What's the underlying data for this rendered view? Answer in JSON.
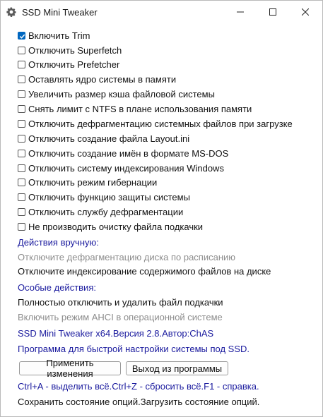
{
  "window": {
    "title": "SSD Mini Tweaker"
  },
  "options": [
    {
      "label": "Включить Trim",
      "checked": true
    },
    {
      "label": "Отключить Superfetch",
      "checked": false
    },
    {
      "label": "Отключить Prefetcher",
      "checked": false
    },
    {
      "label": "Оставлять ядро системы в памяти",
      "checked": false
    },
    {
      "label": "Увеличить размер кэша файловой системы",
      "checked": false
    },
    {
      "label": "Снять лимит с NTFS в плане использования памяти",
      "checked": false
    },
    {
      "label": "Отключить дефрагментацию системных файлов при загрузке",
      "checked": false
    },
    {
      "label": "Отключить создание файла Layout.ini",
      "checked": false
    },
    {
      "label": "Отключить создание имён в формате MS-DOS",
      "checked": false
    },
    {
      "label": "Отключить систему индексирования Windows",
      "checked": false
    },
    {
      "label": "Отключить режим гибернации",
      "checked": false
    },
    {
      "label": "Отключить функцию защиты системы",
      "checked": false
    },
    {
      "label": "Отключить службу дефрагментации",
      "checked": false
    },
    {
      "label": "Не производить очистку файла подкачки",
      "checked": false
    }
  ],
  "manual": {
    "heading": "Действия вручную:",
    "items": [
      {
        "label": "Отключите дефрагментацию диска по расписанию",
        "enabled": false
      },
      {
        "label": "Отключите индексирование содержимого файлов на диске",
        "enabled": true
      }
    ]
  },
  "special": {
    "heading": "Особые действия:",
    "items": [
      {
        "label": "Полностью отключить и удалить файл подкачки",
        "enabled": true
      },
      {
        "label": "Включить режим AHCI в операционной системе",
        "enabled": false
      }
    ]
  },
  "info": {
    "version": "SSD Mini Tweaker x64.Версия 2.8.Автор:ChAS",
    "description": "Программа для быстрой настройки системы под SSD."
  },
  "buttons": {
    "apply": "Применить изменения",
    "exit": "Выход из программы"
  },
  "footer": {
    "shortcuts": "Ctrl+A - выделить всё.Ctrl+Z - сбросить всё.F1 - справка.",
    "state": "Сохранить состояние опций.Загрузить состояние опций."
  },
  "colors": {
    "accent": "#0067c0",
    "link": "#1a1a9e",
    "disabled": "#8c8c8c"
  }
}
